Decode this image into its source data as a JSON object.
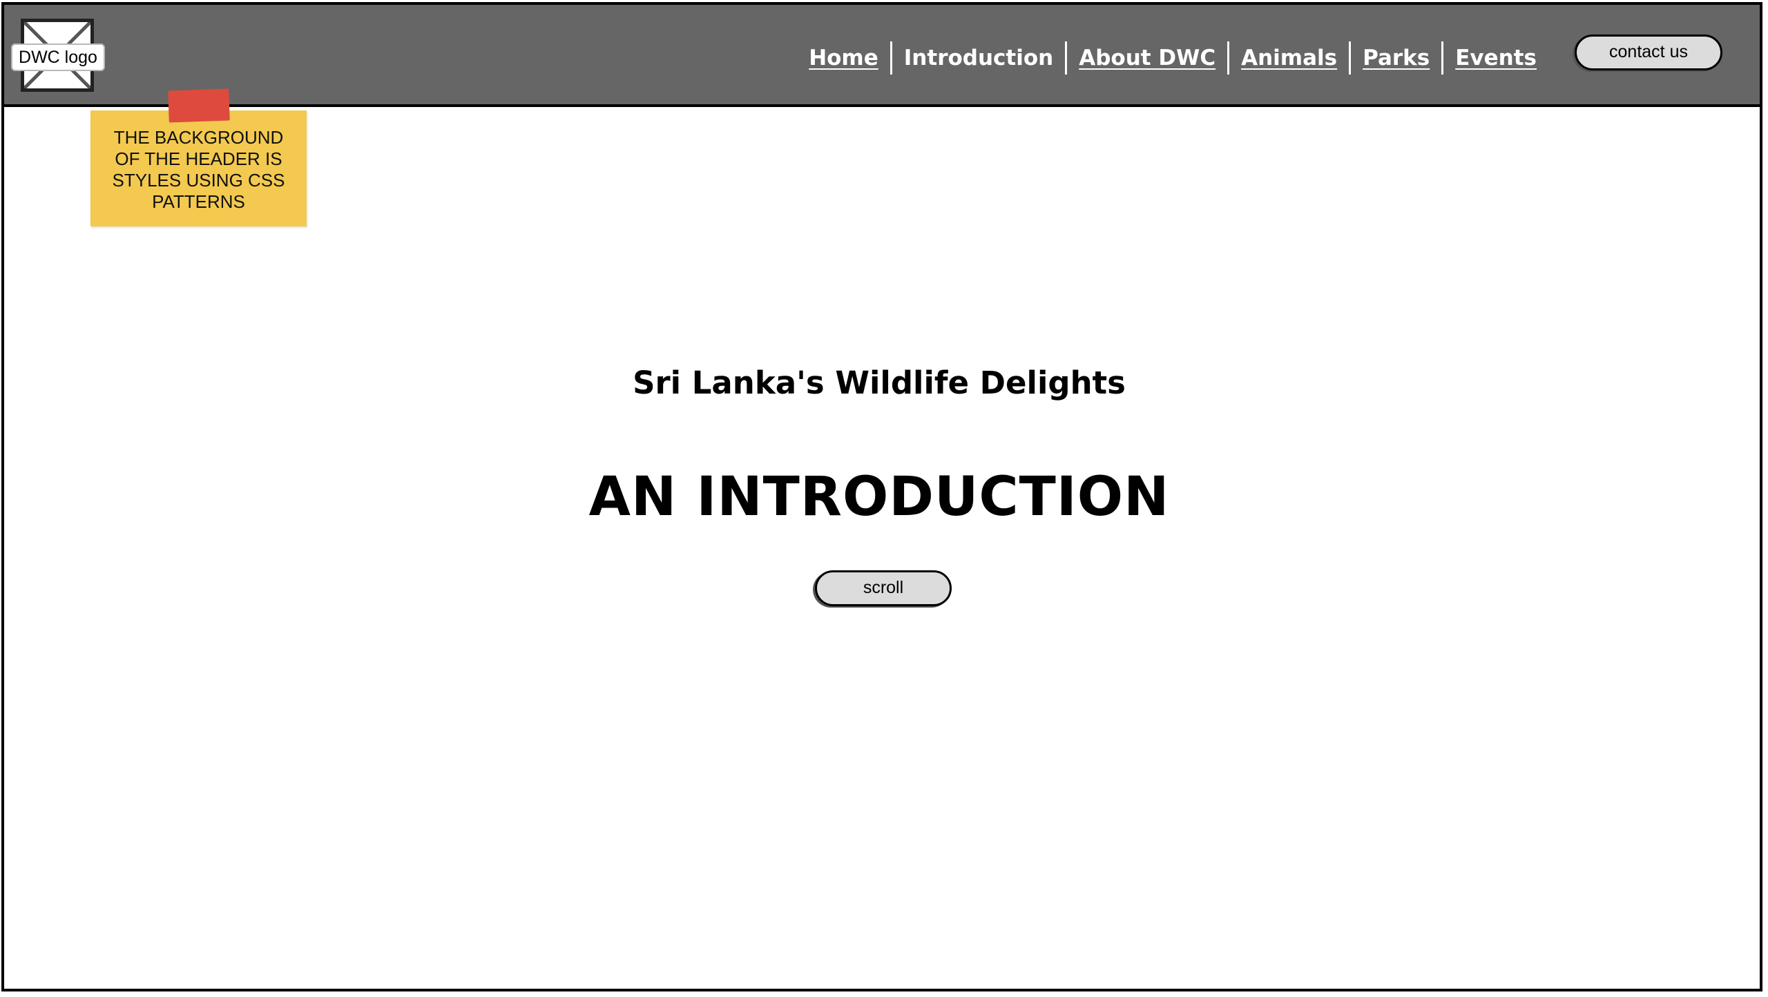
{
  "header": {
    "logo_label": "DWC logo",
    "nav": [
      {
        "label": "Home",
        "active": false
      },
      {
        "label": "Introduction",
        "active": true
      },
      {
        "label": "About DWC",
        "active": false
      },
      {
        "label": "Animals",
        "active": false
      },
      {
        "label": "Parks",
        "active": false
      },
      {
        "label": "Events",
        "active": false
      }
    ],
    "contact_label": "contact us",
    "background_color": "#666666"
  },
  "sticky_note": {
    "text": "THE BACKGROUND OF THE HEADER IS STYLES USING CSS PATTERNS",
    "color": "#f3c94f",
    "tape_color": "#de4a3d"
  },
  "hero": {
    "subtitle": "Sri Lanka's Wildlife Delights",
    "title": "AN INTRODUCTION",
    "scroll_label": "scroll"
  },
  "icons": {
    "logo_placeholder": "image-placeholder-icon"
  }
}
